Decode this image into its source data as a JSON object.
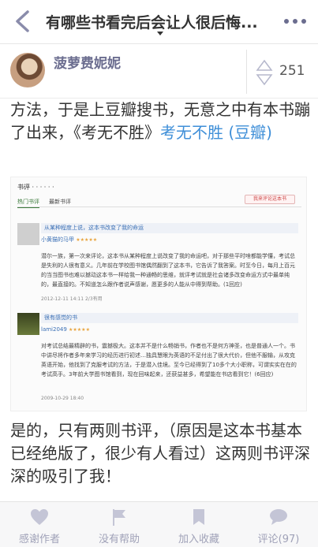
{
  "nav": {
    "title": "有哪些书看完后会让人很后悔..."
  },
  "author": {
    "name": "菠萝费妮妮",
    "votes": "251"
  },
  "content": {
    "para1_text": "方法，于是上豆瓣搜书，无意之中有本书蹦了出来，《考无不胜》",
    "para1_link": "考无不胜 (豆瓣)",
    "para2_text": "是的，只有两则书评，（原因是这本书基本已经绝版了，很少有人看过）这两则书评深深的吸引了我！"
  },
  "screenshot": {
    "header": "书评 · · · · · ·",
    "tab_hot": "热门书评",
    "tab_new": "最新书评",
    "write_button": "我来评论这本书",
    "reviews": [
      {
        "title": "从某种程度上说，这本书改变了我的命运",
        "user": "小黄猫的马甲",
        "stars": "★★★★★",
        "body": "潜尔一族，第一次来评论，这本书从某种程度上说改变了我的命运吧，对于那些平时啥都能学懂，考试总是失利的人很有意义。几年前在学校图书馆偶然翻到了这本书，它告诉了我答案。时至今日，每月上百元的当当图书也难以撼动这本书一样给我一种通畅的思维，就评考试就是社会诸多改变命运方式中最单纯的，最直接的。不知道怎么跟作者说声感谢，愿更多的人能从中得到帮助。(1回应)",
        "meta": "2012-12-11 14:11    2/3有用"
      },
      {
        "title": "很有感觉的书",
        "user": "lami2049",
        "stars": "★★★★★",
        "body": "对考试总结最精辟的书，震撼极大。这本并不是什么畅销书，作者也不是何方神圣，也是普通人一个。书中讲尽将作者多年来学习的经历进行初述…独具慧眼为英语的不足付出了很大代价，但他不服输，从攻克英语开始，他找到了克服考试的方法，于是潜入佳境。至今已经得到了10多个大小职称，可谓实实在在的考试高手。3年前大学图书馆看到，现在回味起来，还获益甚多，希望能在书店看到它！(6回应)",
        "meta": "2009-10-29 18:40"
      }
    ]
  },
  "bottom_bar": {
    "thanks": "感谢作者",
    "no_help": "没有帮助",
    "collect": "加入收藏",
    "comments": "评论(97)"
  },
  "colors": {
    "accent": "#6b6d8f",
    "link": "#3f8fd8",
    "bottom_label": "#a0a2b8"
  }
}
